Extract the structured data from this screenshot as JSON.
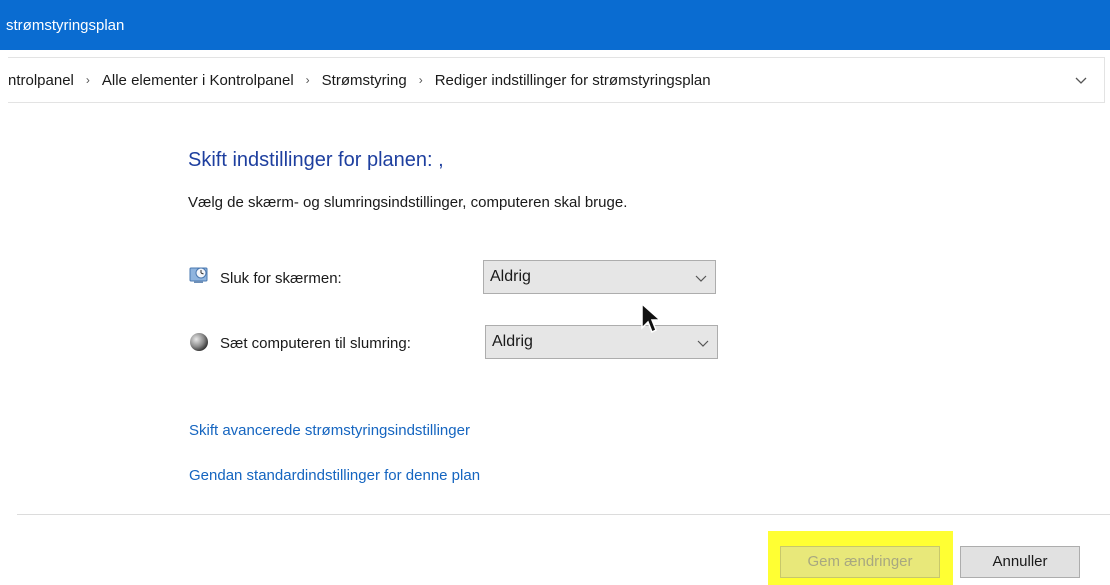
{
  "window": {
    "title": "strømstyringsplan"
  },
  "breadcrumb": {
    "items": [
      "ntrolpanel",
      "Alle elementer i Kontrolpanel",
      "Strømstyring",
      "Rediger indstillinger for strømstyringsplan"
    ],
    "separator": ">"
  },
  "content": {
    "heading": "Skift indstillinger for planen: ,",
    "description": "Vælg de skærm- og slumringsindstillinger, computeren skal bruge.",
    "display_setting": {
      "label": "Sluk for skærmen:",
      "value": "Aldrig",
      "icon": "monitor-clock-icon"
    },
    "sleep_setting": {
      "label": "Sæt computeren til slumring:",
      "value": "Aldrig",
      "icon": "moon-icon"
    },
    "advanced_link": "Skift avancerede strømstyringsindstillinger",
    "restore_link": "Gendan standardindstillinger for denne plan"
  },
  "footer": {
    "save_label": "Gem ændringer",
    "cancel_label": "Annuller",
    "highlight_color": "#ffff33"
  },
  "colors": {
    "titlebar": "#0a6cd1",
    "heading": "#1e3f9f",
    "link": "#1565c0"
  }
}
